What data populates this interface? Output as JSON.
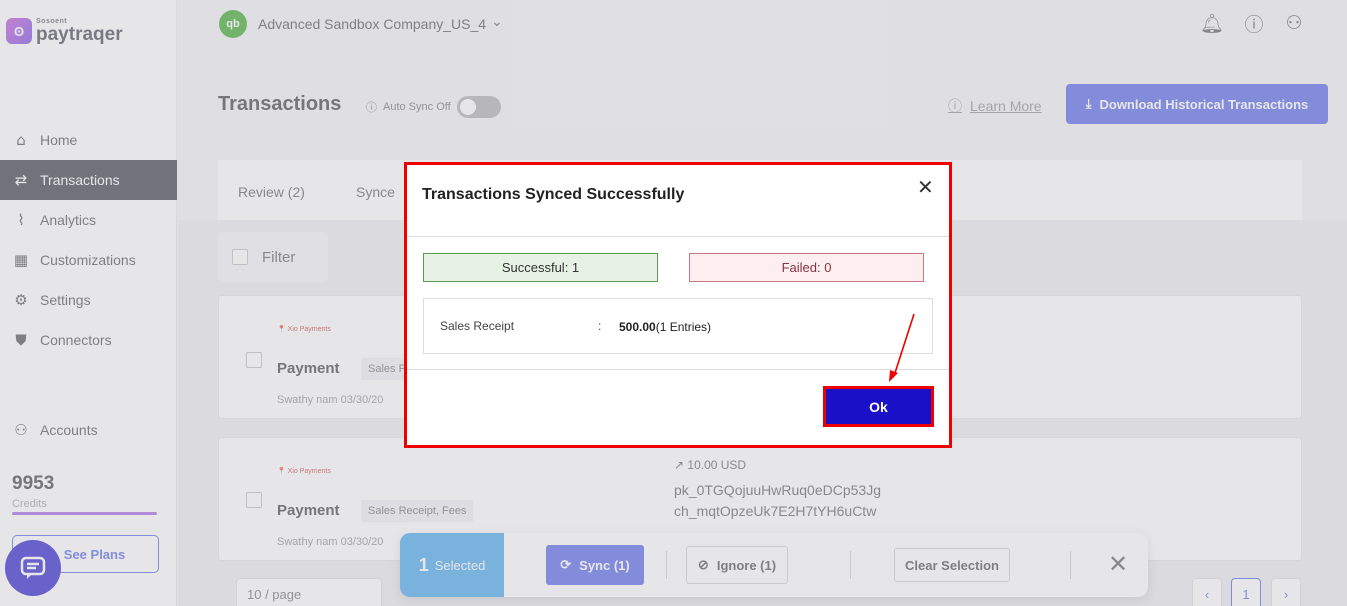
{
  "sidebar": {
    "logo_icon": "ʘ",
    "logo_sub": "Sosoent",
    "logo_main": "paytraqer",
    "items": [
      {
        "label": "Home",
        "icon": "⌂",
        "icon_name": "home-icon"
      },
      {
        "label": "Transactions",
        "icon": "⇄",
        "icon_name": "transactions-icon"
      },
      {
        "label": "Analytics",
        "icon": "📈",
        "icon_name": "analytics-icon"
      },
      {
        "label": "Customizations",
        "icon": "▦",
        "icon_name": "customizations-icon"
      },
      {
        "label": "Settings",
        "icon": "⚙",
        "icon_name": "settings-icon"
      },
      {
        "label": "Connectors",
        "icon": "⛊",
        "icon_name": "connectors-icon"
      }
    ],
    "accounts_label": "Accounts",
    "credits_value": "9953",
    "credits_label": "Credits",
    "see_plans_label": "See Plans"
  },
  "topbar": {
    "company_logo": "qb",
    "company_name": "Advanced Sandbox Company_US_4",
    "chevron": "⌄"
  },
  "header": {
    "title": "Transactions",
    "autosync_label": "Auto Sync Off",
    "learn_more": "Learn More",
    "download_button": "Download Historical Transactions"
  },
  "tabs": [
    {
      "label": "Review (2)"
    },
    {
      "label": "Synce"
    }
  ],
  "filter_label": "Filter",
  "cards": [
    {
      "brand": "📍 Xio Payments",
      "title": "Payment",
      "tag": "Sales F",
      "meta": "Swathy nam  03/30/20"
    },
    {
      "brand": "📍 Xio Payments",
      "title": "Payment",
      "tag": "Sales Receipt, Fees",
      "meta": "Swathy nam  03/30/20",
      "amount": "10.00 USD",
      "id1": "pk_0TGQojuuHwRuq0eDCp53Jg",
      "id2": "ch_mqtOpzeUk7E2H7tYH6uCtw"
    }
  ],
  "pagination": {
    "page_size": "10 / page",
    "current": "1"
  },
  "selection_bar": {
    "count": "1",
    "selected_label": "Selected",
    "sync_label": "Sync (1)",
    "ignore_label": "Ignore (1)",
    "clear_label": "Clear Selection"
  },
  "modal": {
    "title": "Transactions Synced Successfully",
    "successful": "Successful: 1",
    "failed": "Failed: 0",
    "entry_label": "Sales Receipt",
    "entry_colon": ":",
    "entry_amount": "500.00",
    "entry_count": "(1 Entries)",
    "ok_label": "Ok"
  },
  "colors": {
    "accent": "#4b5be6",
    "ok_button": "#1a10c8",
    "highlight": "#e00000"
  }
}
